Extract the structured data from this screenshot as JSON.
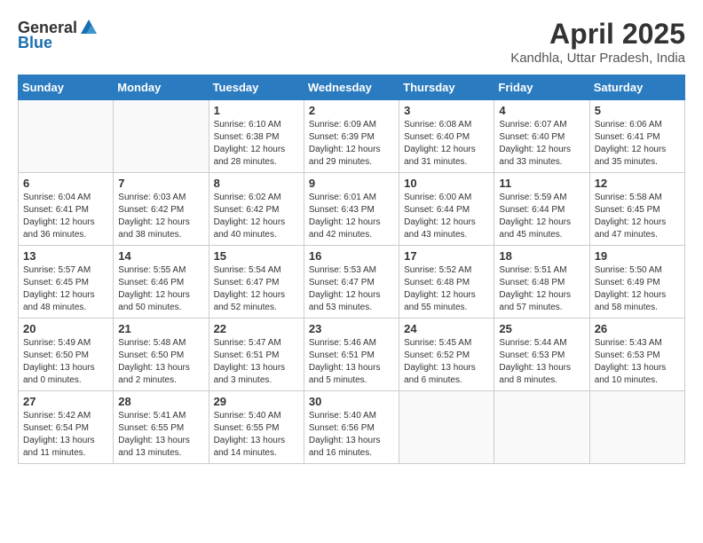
{
  "header": {
    "logo_general": "General",
    "logo_blue": "Blue",
    "month_year": "April 2025",
    "location": "Kandhla, Uttar Pradesh, India"
  },
  "weekdays": [
    "Sunday",
    "Monday",
    "Tuesday",
    "Wednesday",
    "Thursday",
    "Friday",
    "Saturday"
  ],
  "weeks": [
    [
      {
        "day": "",
        "info": ""
      },
      {
        "day": "",
        "info": ""
      },
      {
        "day": "1",
        "info": "Sunrise: 6:10 AM\nSunset: 6:38 PM\nDaylight: 12 hours\nand 28 minutes."
      },
      {
        "day": "2",
        "info": "Sunrise: 6:09 AM\nSunset: 6:39 PM\nDaylight: 12 hours\nand 29 minutes."
      },
      {
        "day": "3",
        "info": "Sunrise: 6:08 AM\nSunset: 6:40 PM\nDaylight: 12 hours\nand 31 minutes."
      },
      {
        "day": "4",
        "info": "Sunrise: 6:07 AM\nSunset: 6:40 PM\nDaylight: 12 hours\nand 33 minutes."
      },
      {
        "day": "5",
        "info": "Sunrise: 6:06 AM\nSunset: 6:41 PM\nDaylight: 12 hours\nand 35 minutes."
      }
    ],
    [
      {
        "day": "6",
        "info": "Sunrise: 6:04 AM\nSunset: 6:41 PM\nDaylight: 12 hours\nand 36 minutes."
      },
      {
        "day": "7",
        "info": "Sunrise: 6:03 AM\nSunset: 6:42 PM\nDaylight: 12 hours\nand 38 minutes."
      },
      {
        "day": "8",
        "info": "Sunrise: 6:02 AM\nSunset: 6:42 PM\nDaylight: 12 hours\nand 40 minutes."
      },
      {
        "day": "9",
        "info": "Sunrise: 6:01 AM\nSunset: 6:43 PM\nDaylight: 12 hours\nand 42 minutes."
      },
      {
        "day": "10",
        "info": "Sunrise: 6:00 AM\nSunset: 6:44 PM\nDaylight: 12 hours\nand 43 minutes."
      },
      {
        "day": "11",
        "info": "Sunrise: 5:59 AM\nSunset: 6:44 PM\nDaylight: 12 hours\nand 45 minutes."
      },
      {
        "day": "12",
        "info": "Sunrise: 5:58 AM\nSunset: 6:45 PM\nDaylight: 12 hours\nand 47 minutes."
      }
    ],
    [
      {
        "day": "13",
        "info": "Sunrise: 5:57 AM\nSunset: 6:45 PM\nDaylight: 12 hours\nand 48 minutes."
      },
      {
        "day": "14",
        "info": "Sunrise: 5:55 AM\nSunset: 6:46 PM\nDaylight: 12 hours\nand 50 minutes."
      },
      {
        "day": "15",
        "info": "Sunrise: 5:54 AM\nSunset: 6:47 PM\nDaylight: 12 hours\nand 52 minutes."
      },
      {
        "day": "16",
        "info": "Sunrise: 5:53 AM\nSunset: 6:47 PM\nDaylight: 12 hours\nand 53 minutes."
      },
      {
        "day": "17",
        "info": "Sunrise: 5:52 AM\nSunset: 6:48 PM\nDaylight: 12 hours\nand 55 minutes."
      },
      {
        "day": "18",
        "info": "Sunrise: 5:51 AM\nSunset: 6:48 PM\nDaylight: 12 hours\nand 57 minutes."
      },
      {
        "day": "19",
        "info": "Sunrise: 5:50 AM\nSunset: 6:49 PM\nDaylight: 12 hours\nand 58 minutes."
      }
    ],
    [
      {
        "day": "20",
        "info": "Sunrise: 5:49 AM\nSunset: 6:50 PM\nDaylight: 13 hours\nand 0 minutes."
      },
      {
        "day": "21",
        "info": "Sunrise: 5:48 AM\nSunset: 6:50 PM\nDaylight: 13 hours\nand 2 minutes."
      },
      {
        "day": "22",
        "info": "Sunrise: 5:47 AM\nSunset: 6:51 PM\nDaylight: 13 hours\nand 3 minutes."
      },
      {
        "day": "23",
        "info": "Sunrise: 5:46 AM\nSunset: 6:51 PM\nDaylight: 13 hours\nand 5 minutes."
      },
      {
        "day": "24",
        "info": "Sunrise: 5:45 AM\nSunset: 6:52 PM\nDaylight: 13 hours\nand 6 minutes."
      },
      {
        "day": "25",
        "info": "Sunrise: 5:44 AM\nSunset: 6:53 PM\nDaylight: 13 hours\nand 8 minutes."
      },
      {
        "day": "26",
        "info": "Sunrise: 5:43 AM\nSunset: 6:53 PM\nDaylight: 13 hours\nand 10 minutes."
      }
    ],
    [
      {
        "day": "27",
        "info": "Sunrise: 5:42 AM\nSunset: 6:54 PM\nDaylight: 13 hours\nand 11 minutes."
      },
      {
        "day": "28",
        "info": "Sunrise: 5:41 AM\nSunset: 6:55 PM\nDaylight: 13 hours\nand 13 minutes."
      },
      {
        "day": "29",
        "info": "Sunrise: 5:40 AM\nSunset: 6:55 PM\nDaylight: 13 hours\nand 14 minutes."
      },
      {
        "day": "30",
        "info": "Sunrise: 5:40 AM\nSunset: 6:56 PM\nDaylight: 13 hours\nand 16 minutes."
      },
      {
        "day": "",
        "info": ""
      },
      {
        "day": "",
        "info": ""
      },
      {
        "day": "",
        "info": ""
      }
    ]
  ]
}
